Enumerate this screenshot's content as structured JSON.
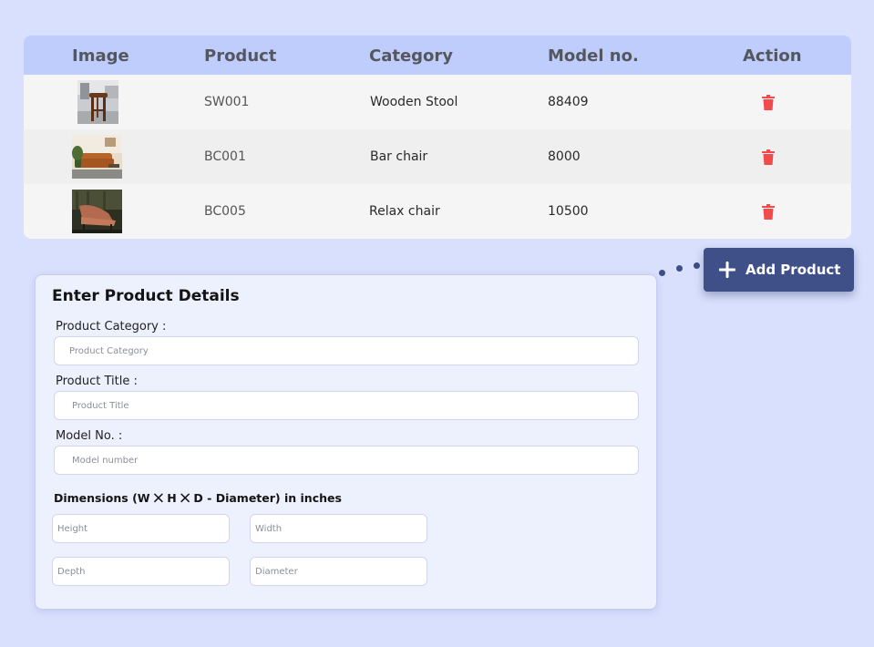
{
  "table": {
    "headers": [
      "Image",
      "Product",
      "Category",
      "Model no.",
      "Action"
    ],
    "rows": [
      {
        "image": "wooden-stool-photo",
        "product": "SW001",
        "category": "Wooden Stool",
        "model": "88409",
        "action": "trash-icon"
      },
      {
        "image": "bar-chair-photo",
        "product": "BC001",
        "category": "Bar chair",
        "model": "8000",
        "action": "trash-icon"
      },
      {
        "image": "relax-chair-photo",
        "product": "BC005",
        "category": "Relax chair",
        "model": "10500",
        "action": "trash-icon"
      }
    ]
  },
  "add_button": {
    "label": "Add Product",
    "icon": "plus-icon"
  },
  "form": {
    "title": "Enter Product Details",
    "category_label": "Product Category :",
    "category_placeholder": "Product Category",
    "title_label": "Product Title :",
    "title_placeholder": "Product Title",
    "model_label": "Model No. :",
    "model_placeholder": "Model number",
    "dims_title": "Dimensions (W ⨉ H ⨉ D - Diameter) in inches",
    "height_placeholder": "Height",
    "width_placeholder": "Width",
    "depth_placeholder": "Depth",
    "diameter_placeholder": "Diameter"
  },
  "colors": {
    "background": "#d9e0fd",
    "table_header": "#bfcdfd",
    "accent_button": "#3f5089",
    "delete_red": "#f04a4a"
  }
}
